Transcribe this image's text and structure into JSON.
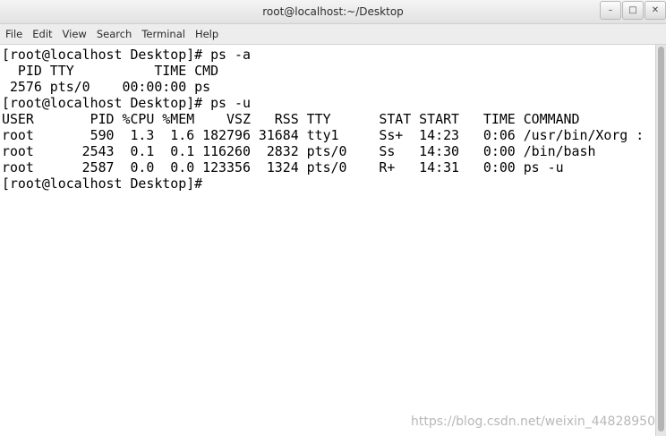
{
  "window": {
    "title": "root@localhost:~/Desktop",
    "controls": {
      "minimize": "–",
      "maximize": "□",
      "close": "✕"
    }
  },
  "menubar": {
    "items": [
      "File",
      "Edit",
      "View",
      "Search",
      "Terminal",
      "Help"
    ]
  },
  "terminal": {
    "lines": [
      "[root@localhost Desktop]# ps -a",
      "  PID TTY          TIME CMD",
      " 2576 pts/0    00:00:00 ps",
      "[root@localhost Desktop]# ps -u",
      "USER       PID %CPU %MEM    VSZ   RSS TTY      STAT START   TIME COMMAND",
      "root       590  1.3  1.6 182796 31684 tty1     Ss+  14:23   0:06 /usr/bin/Xorg :",
      "root      2543  0.1  0.1 116260  2832 pts/0    Ss   14:30   0:00 /bin/bash",
      "root      2587  0.0  0.0 123356  1324 pts/0    R+   14:31   0:00 ps -u",
      "[root@localhost Desktop]# "
    ]
  },
  "watermark": "https://blog.csdn.net/weixin_44828950"
}
